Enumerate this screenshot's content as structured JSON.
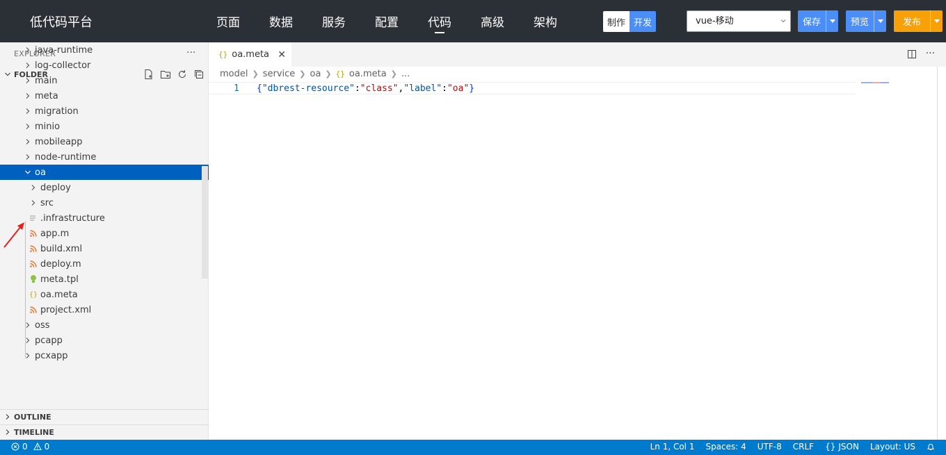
{
  "app": {
    "title": "低代码平台"
  },
  "nav": {
    "items": [
      {
        "label": "页面"
      },
      {
        "label": "数据"
      },
      {
        "label": "服务"
      },
      {
        "label": "配置"
      },
      {
        "label": "代码"
      },
      {
        "label": "高级"
      },
      {
        "label": "架构"
      }
    ],
    "active": "代码"
  },
  "mode": {
    "make": "制作",
    "develop": "开发",
    "selected": "开发"
  },
  "target_select": {
    "value": "vue-移动"
  },
  "actions": {
    "save": "保存",
    "preview": "预览",
    "publish": "发布"
  },
  "colors": {
    "topbar": "#2b2f36",
    "accent_blue": "#4c8ef7",
    "accent_orange": "#f7a007",
    "selection": "#0060c0",
    "statusbar": "#007acc"
  },
  "sidebar": {
    "explorer_title": "EXPLORER",
    "folder_title": "FOLDER",
    "outline_title": "OUTLINE",
    "timeline_title": "TIMELINE",
    "folder_action_icons": [
      "new-file-icon",
      "new-folder-icon",
      "refresh-icon",
      "collapse-all-icon"
    ],
    "tree": [
      {
        "label": "java-runtime",
        "type": "folder",
        "depth": 0,
        "expanded": false
      },
      {
        "label": "log-collector",
        "type": "folder",
        "depth": 0,
        "expanded": false
      },
      {
        "label": "main",
        "type": "folder",
        "depth": 0,
        "expanded": false
      },
      {
        "label": "meta",
        "type": "folder",
        "depth": 0,
        "expanded": false
      },
      {
        "label": "migration",
        "type": "folder",
        "depth": 0,
        "expanded": false
      },
      {
        "label": "minio",
        "type": "folder",
        "depth": 0,
        "expanded": false
      },
      {
        "label": "mobileapp",
        "type": "folder",
        "depth": 0,
        "expanded": false
      },
      {
        "label": "node-runtime",
        "type": "folder",
        "depth": 0,
        "expanded": false
      },
      {
        "label": "oa",
        "type": "folder",
        "depth": 0,
        "expanded": true,
        "selected": true
      },
      {
        "label": "deploy",
        "type": "folder",
        "depth": 1,
        "expanded": false
      },
      {
        "label": "src",
        "type": "folder",
        "depth": 1,
        "expanded": false
      },
      {
        "label": ".infrastructure",
        "type": "file",
        "depth": 1,
        "icon": "lines-file-icon"
      },
      {
        "label": "app.m",
        "type": "file",
        "depth": 1,
        "icon": "rss-file-icon"
      },
      {
        "label": "build.xml",
        "type": "file",
        "depth": 1,
        "icon": "rss-file-icon"
      },
      {
        "label": "deploy.m",
        "type": "file",
        "depth": 1,
        "icon": "rss-file-icon"
      },
      {
        "label": "meta.tpl",
        "type": "file",
        "depth": 1,
        "icon": "lightbulb-file-icon"
      },
      {
        "label": "oa.meta",
        "type": "file",
        "depth": 1,
        "icon": "json-braces-icon"
      },
      {
        "label": "project.xml",
        "type": "file",
        "depth": 1,
        "icon": "rss-file-icon"
      },
      {
        "label": "oss",
        "type": "folder",
        "depth": 0,
        "expanded": false
      },
      {
        "label": "pcapp",
        "type": "folder",
        "depth": 0,
        "expanded": false
      },
      {
        "label": "pcxapp",
        "type": "folder",
        "depth": 0,
        "expanded": false
      }
    ]
  },
  "editor": {
    "tab": {
      "label": "oa.meta",
      "icon": "{}"
    },
    "breadcrumb": [
      "model",
      "service",
      "oa",
      "oa.meta",
      "..."
    ],
    "line_number": "1",
    "code_tokens": [
      {
        "t": "{",
        "k": "brace"
      },
      {
        "t": "\"dbrest-resource\"",
        "k": "key"
      },
      {
        "t": ":",
        "k": "punc"
      },
      {
        "t": "\"class\"",
        "k": "str"
      },
      {
        "t": ",",
        "k": "punc"
      },
      {
        "t": "\"label\"",
        "k": "key"
      },
      {
        "t": ":",
        "k": "punc"
      },
      {
        "t": "\"oa\"",
        "k": "str"
      },
      {
        "t": "}",
        "k": "brace"
      }
    ]
  },
  "status": {
    "errors": "0",
    "warnings": "0",
    "position": "Ln 1, Col 1",
    "spaces": "Spaces: 4",
    "encoding": "UTF-8",
    "eol": "CRLF",
    "language": "JSON",
    "layout": "Layout: US"
  }
}
